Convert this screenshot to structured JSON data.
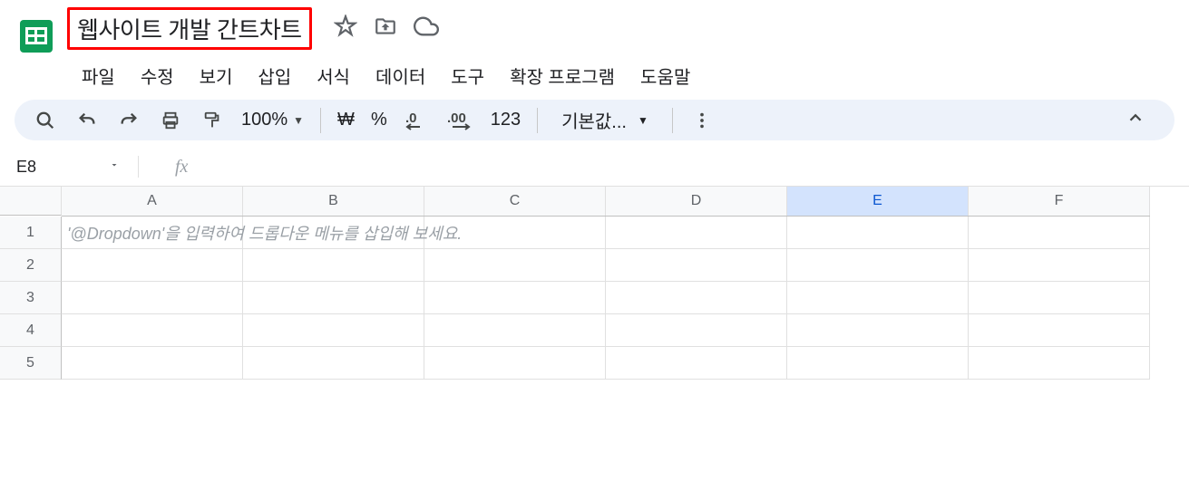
{
  "header": {
    "title": "웹사이트 개발 간트차트"
  },
  "menu": {
    "file": "파일",
    "edit": "수정",
    "view": "보기",
    "insert": "삽입",
    "format": "서식",
    "data": "데이터",
    "tools": "도구",
    "extensions": "확장 프로그램",
    "help": "도움말"
  },
  "toolbar": {
    "zoom": "100%",
    "currency": "₩",
    "percent": "%",
    "decrease_decimal": ".0",
    "increase_decimal": ".00",
    "number_format": "123",
    "font": "기본값..."
  },
  "namebox": {
    "cell": "E8",
    "fx": "fx"
  },
  "columns": [
    "A",
    "B",
    "C",
    "D",
    "E",
    "F"
  ],
  "rows": [
    "1",
    "2",
    "3",
    "4",
    "5"
  ],
  "cells": {
    "A1": "'@Dropdown'을 입력하여 드롭다운 메뉴를 삽입해 보세요."
  },
  "selected_column": "E"
}
